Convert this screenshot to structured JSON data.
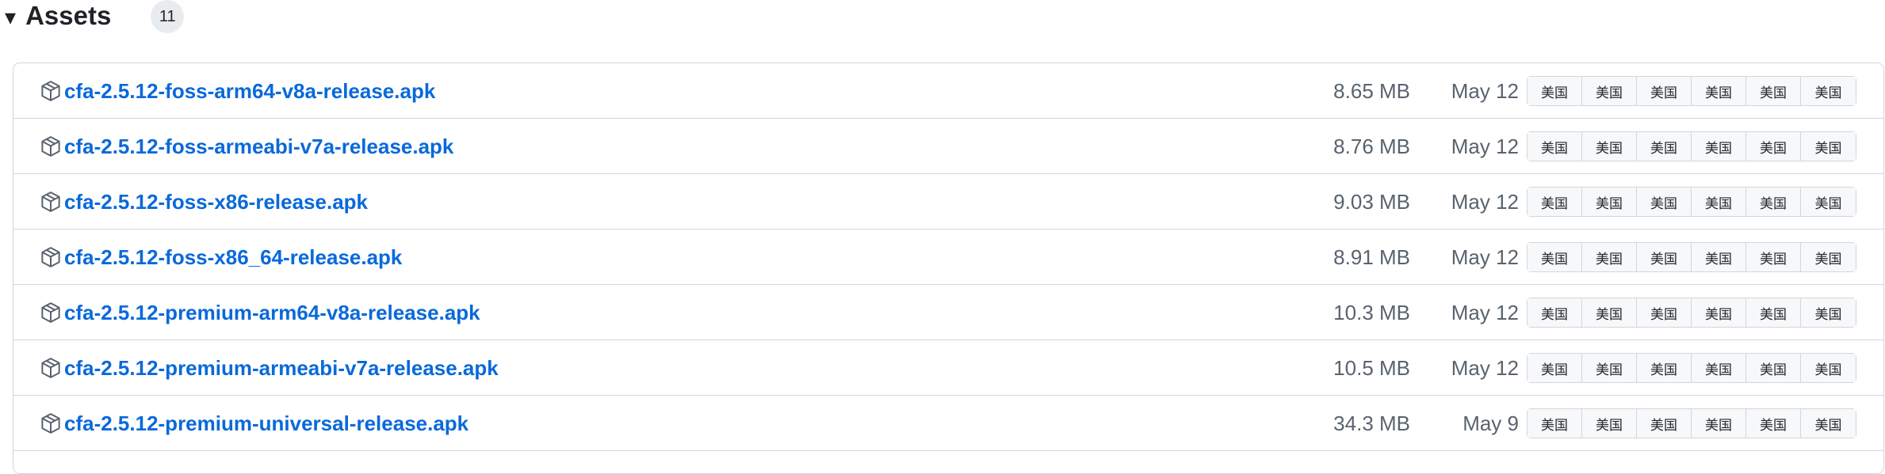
{
  "header": {
    "caret": "▾",
    "title": "Assets",
    "count": "11"
  },
  "assets": [
    {
      "name": "cfa-2.5.12-foss-arm64-v8a-release.apk",
      "size": "8.65 MB",
      "date": "May 12"
    },
    {
      "name": "cfa-2.5.12-foss-armeabi-v7a-release.apk",
      "size": "8.76 MB",
      "date": "May 12"
    },
    {
      "name": "cfa-2.5.12-foss-x86-release.apk",
      "size": "9.03 MB",
      "date": "May 12"
    },
    {
      "name": "cfa-2.5.12-foss-x86_64-release.apk",
      "size": "8.91 MB",
      "date": "May 12"
    },
    {
      "name": "cfa-2.5.12-premium-arm64-v8a-release.apk",
      "size": "10.3 MB",
      "date": "May 12"
    },
    {
      "name": "cfa-2.5.12-premium-armeabi-v7a-release.apk",
      "size": "10.5 MB",
      "date": "May 12"
    },
    {
      "name": "cfa-2.5.12-premium-universal-release.apk",
      "size": "34.3 MB",
      "date": "May 9"
    }
  ],
  "mirror_buttons": [
    "美国",
    "美国",
    "美国",
    "美国",
    "美国",
    "美国"
  ],
  "icons": {
    "file": "package-icon"
  },
  "colors": {
    "link": "#0969da",
    "muted": "#59636e",
    "border": "#d0d7de"
  }
}
